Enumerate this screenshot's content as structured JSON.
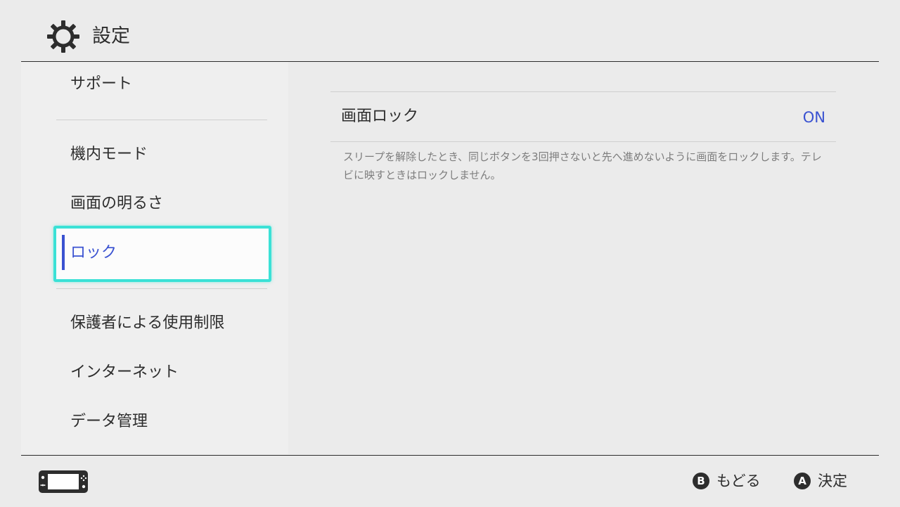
{
  "header": {
    "title": "設定",
    "icon": "gear-icon"
  },
  "sidebar": {
    "items": [
      {
        "label": "サポート"
      },
      {
        "label": "機内モード"
      },
      {
        "label": "画面の明るさ"
      },
      {
        "label": "ロック",
        "selected": true
      },
      {
        "label": "保護者による使用制限"
      },
      {
        "label": "インターネット"
      },
      {
        "label": "データ管理"
      }
    ]
  },
  "main": {
    "setting": {
      "name": "画面ロック",
      "value": "ON"
    },
    "description": "スリープを解除したとき、同じボタンを3回押さないと先へ進めないように画面をロックします。テレビに映すときはロックしません。"
  },
  "footer": {
    "back": {
      "button": "B",
      "label": "もどる"
    },
    "confirm": {
      "button": "A",
      "label": "決定"
    },
    "console_icon": "handheld-console-icon"
  },
  "colors": {
    "accent": "#3a52d1",
    "focus_border": "#3be1d6",
    "background": "#ebebeb",
    "text": "#2d2d2d"
  }
}
